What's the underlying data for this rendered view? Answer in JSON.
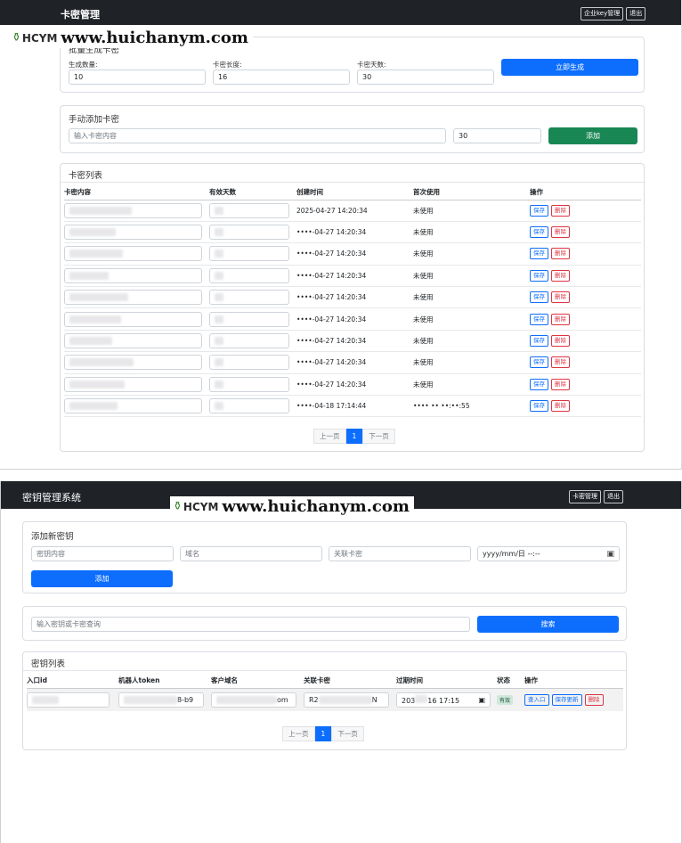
{
  "screen1": {
    "navbar": {
      "title": "卡密管理",
      "buttons": [
        "企业key管理",
        "退出"
      ]
    },
    "watermark": {
      "logo": "HCYM",
      "url": "www.huichanym.com"
    },
    "batch": {
      "title": "批量生成卡密",
      "quantity_label": "生成数量:",
      "quantity_value": "10",
      "length_label": "卡密长度:",
      "length_value": "16",
      "days_label": "卡密天数:",
      "days_value": "30",
      "generate_button": "立即生成"
    },
    "manual": {
      "title": "手动添加卡密",
      "content_placeholder": "输入卡密内容",
      "days_value": "30",
      "add_button": "添加"
    },
    "list": {
      "title": "卡密列表",
      "columns": [
        "卡密内容",
        "有效天数",
        "创建时间",
        "首次使用",
        "操作"
      ],
      "rows": [
        {
          "created": "2025-04-27 14:20:34",
          "first_use": "未使用"
        },
        {
          "created": "••••-04-27 14:20:34",
          "first_use": "未使用"
        },
        {
          "created": "••••-04-27 14:20:34",
          "first_use": "未使用"
        },
        {
          "created": "••••-04-27 14:20:34",
          "first_use": "未使用"
        },
        {
          "created": "••••-04-27 14:20:34",
          "first_use": "未使用"
        },
        {
          "created": "••••-04-27 14:20:34",
          "first_use": "未使用"
        },
        {
          "created": "••••-04-27 14:20:34",
          "first_use": "未使用"
        },
        {
          "created": "••••-04-27 14:20:34",
          "first_use": "未使用"
        },
        {
          "created": "••••-04-27 14:20:34",
          "first_use": "未使用"
        },
        {
          "created": "••••-04-18 17:14:44",
          "first_use": "•••• •• ••:••:55"
        }
      ],
      "save_label": "保存",
      "delete_label": "删除",
      "pagination": {
        "prev": "上一页",
        "current": "1",
        "next": "下一页"
      }
    }
  },
  "screen2": {
    "navbar": {
      "title": "密钥管理系统",
      "buttons": [
        "卡密管理",
        "退出"
      ]
    },
    "watermark": {
      "logo": "HCYM",
      "url": "www.huichanym.com"
    },
    "add": {
      "title": "添加新密钥",
      "key_placeholder": "密钥内容",
      "domain_placeholder": "域名",
      "card_placeholder": "关联卡密",
      "date_placeholder": "yyyy/mm/日 --:--",
      "add_button": "添加"
    },
    "search": {
      "placeholder": "输入密钥或卡密查询",
      "button": "搜索"
    },
    "list": {
      "title": "密钥列表",
      "columns": [
        "入口id",
        "机器人token",
        "客户域名",
        "关联卡密",
        "过期时间",
        "状态",
        "操作"
      ],
      "rows": [
        {
          "token_tail": "8-b9",
          "domain_tail": "om",
          "card_head": "R2",
          "card_tail": "N",
          "expire_head": "203",
          "expire_tail": "16 17:15",
          "status": "有效"
        }
      ],
      "row_actions": [
        "查入口",
        "保存更新",
        "删除"
      ],
      "pagination": {
        "prev": "上一页",
        "current": "1",
        "next": "下一页"
      }
    }
  }
}
